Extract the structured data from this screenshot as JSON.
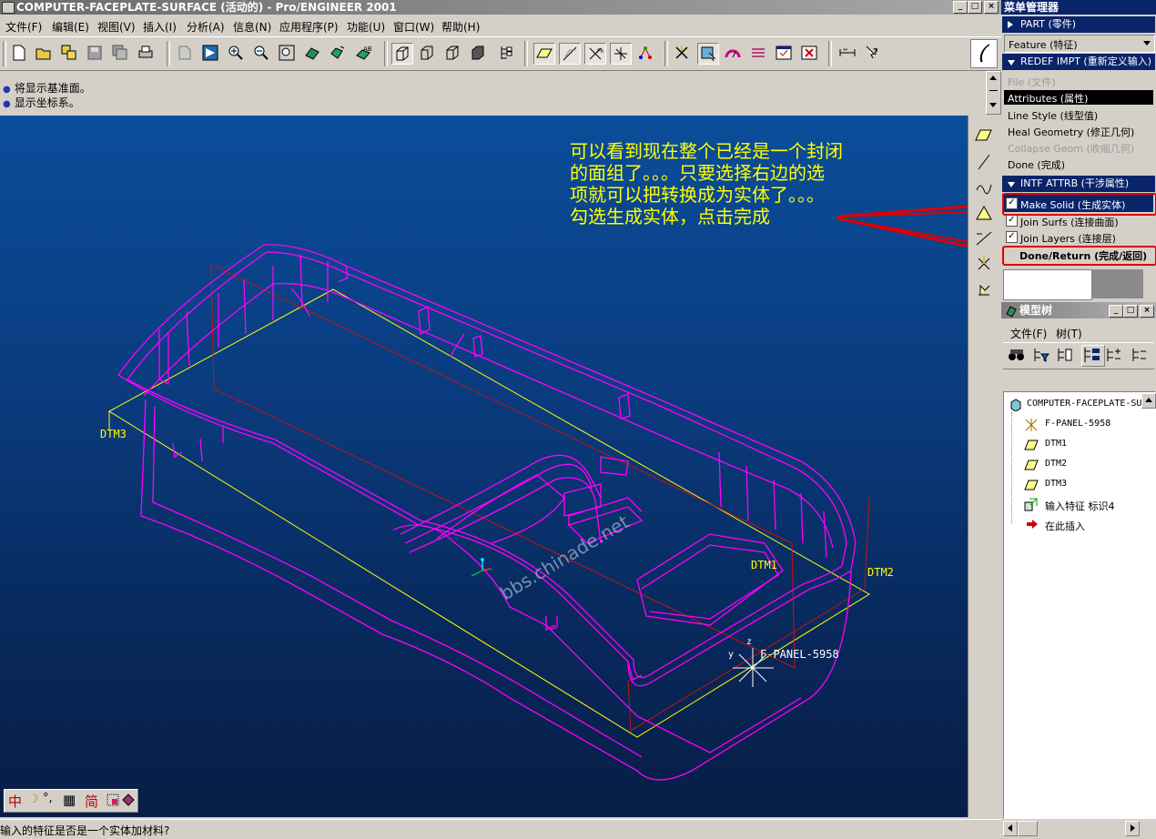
{
  "window": {
    "title": "COMPUTER-FACEPLATE-SURFACE (活动的) - Pro/ENGINEER 2001",
    "min_glyph": "_",
    "max_glyph": "□",
    "close_glyph": "×"
  },
  "menubar": {
    "items": [
      "文件(F)",
      "编辑(E)",
      "视图(V)",
      "插入(I)",
      "分析(A)",
      "信息(N)",
      "应用程序(P)",
      "功能(U)",
      "窗口(W)",
      "帮助(H)"
    ]
  },
  "messages": {
    "lines": [
      "将显示基准面。",
      "显示坐标系。"
    ]
  },
  "menu_manager": {
    "title": "菜单管理器",
    "part_header": "PART (零件)",
    "feature_dropdown": "Feature (特征)",
    "redef_header": "REDEF IMPT (重新定义输入)",
    "redef_items": [
      {
        "label": "File (文件)",
        "state": "disabled"
      },
      {
        "label": "Attributes (属性)",
        "state": "selected"
      },
      {
        "label": "Line Style (线型值)",
        "state": "normal"
      },
      {
        "label": "Heal Geometry (修正几何)",
        "state": "normal"
      },
      {
        "label": "Collapse Geom (收缩几何)",
        "state": "disabled"
      },
      {
        "label": "Done (完成)",
        "state": "normal"
      }
    ],
    "intf_header": "INTF ATTRB (干涉属性)",
    "intf_items": [
      {
        "label": "Make Solid (生成实体)",
        "checked": true,
        "highlight": true
      },
      {
        "label": "Join Surfs (连接曲面)",
        "checked": true,
        "highlight": false
      },
      {
        "label": "Join Layers (连接层)",
        "checked": true,
        "highlight": false
      }
    ],
    "done_return": "Done/Return (完成/返回)"
  },
  "model_tree": {
    "title": "模型树",
    "menu": [
      "文件(F)",
      "树(T)"
    ],
    "items": [
      {
        "label": "COMPUTER-FACEPLATE-SURFACE",
        "icon": "part-icon",
        "level": 0
      },
      {
        "label": "F-PANEL-5958",
        "icon": "csys-icon",
        "level": 1
      },
      {
        "label": "DTM1",
        "icon": "datum-plane-icon",
        "level": 1
      },
      {
        "label": "DTM2",
        "icon": "datum-plane-icon",
        "level": 1
      },
      {
        "label": "DTM3",
        "icon": "datum-plane-icon",
        "level": 1
      },
      {
        "label": "输入特征 标识4",
        "icon": "import-feature-icon",
        "level": 1
      },
      {
        "label": "在此插入",
        "icon": "insert-here-arrow-icon",
        "level": 1
      }
    ]
  },
  "viewport": {
    "annotation": [
      "可以看到现在整个已经是一个封闭",
      "的面组了。。。只要选择右边的选",
      "项就可以把转换成为实体了。。。",
      "勾选生成实体，点击完成"
    ],
    "watermark": "bbs.chinade.net",
    "datum_labels": {
      "dtm1": "DTM1",
      "dtm2": "DTM2",
      "dtm3": "DTM3",
      "csys": "F-PANEL-5958",
      "csys_y": "y",
      "csys_z": "z"
    }
  },
  "ime": {
    "chinese_glyph": "中",
    "moon_glyph": "☽",
    "punct_glyph": "°,",
    "keyboard_glyph": "▦",
    "simplified_glyph": "简"
  },
  "status": {
    "prompt": "输入的特征是否是一个实体加材料?"
  },
  "colors": {
    "accent_blue": "#0a246a",
    "annotation": "#ffff00",
    "highlight_red": "#e00000",
    "wireframe": "#ff00ff",
    "datum": "#ffff00",
    "datum_red": "#cc0000"
  }
}
